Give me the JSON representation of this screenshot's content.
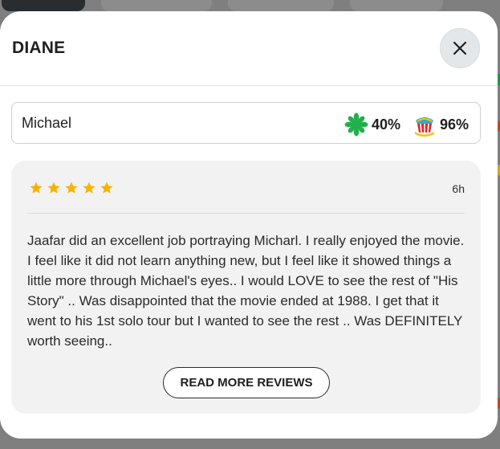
{
  "modal": {
    "title": "DIANE",
    "close_icon": "close-icon"
  },
  "reviewer": {
    "name": "Michael",
    "tomatometer": {
      "icon": "green-splat-icon",
      "value": "40%"
    },
    "popcornmeter": {
      "icon": "popcorn-bucket-icon",
      "value": "96%"
    }
  },
  "review": {
    "rating_stars": 5,
    "time": "6h",
    "text": "Jaafar did an excellent job portraying Micharl. I really enjoyed the movie. I feel like it did not learn anything new, but I feel like it showed things a little more through Michael's eyes.. I would LOVE to see the rest of \"His Story\" .. Was disappointed that the movie ended at 1988. I get that it went to his 1st solo tour but I wanted to see the rest .. Was DEFINITELY worth seeing..",
    "read_more_label": "READ MORE REVIEWS"
  },
  "colors": {
    "star": "#f5b301",
    "splat": "#21b04b",
    "popcorn": "#f7c500",
    "overlay": "#7f7f7f"
  }
}
